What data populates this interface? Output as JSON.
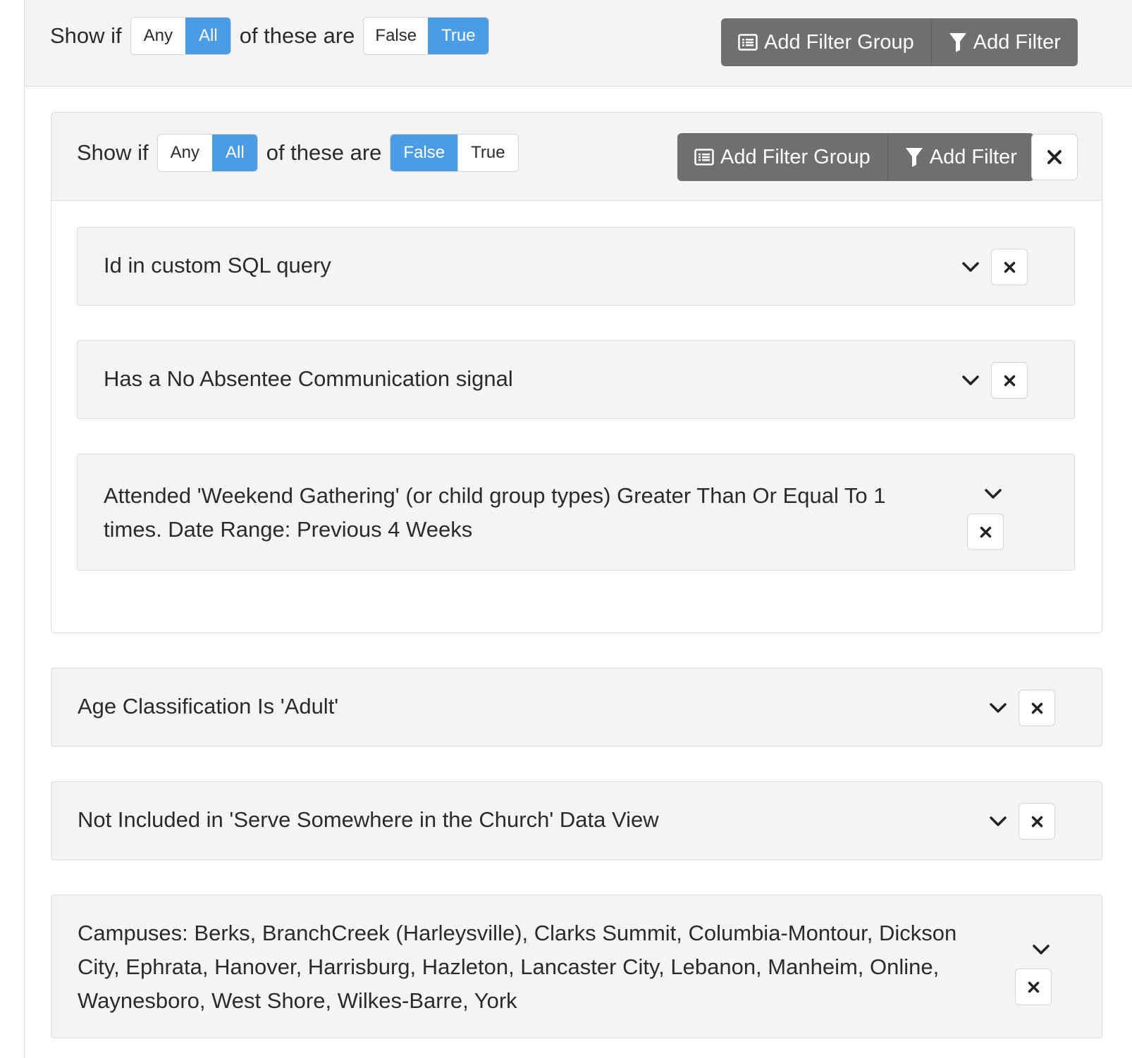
{
  "root": {
    "show_if": "Show if",
    "any": "Any",
    "all": "All",
    "of_these_are": "of these are",
    "false": "False",
    "true": "True",
    "selected_match": "All",
    "selected_value": "True",
    "add_filter_group": "Add Filter Group",
    "add_filter": "Add Filter"
  },
  "group": {
    "show_if": "Show if",
    "any": "Any",
    "all": "All",
    "of_these_are": "of these are",
    "false": "False",
    "true": "True",
    "selected_match": "All",
    "selected_value": "False",
    "add_filter_group": "Add Filter Group",
    "add_filter": "Add Filter",
    "filters": [
      {
        "label": "Id in custom SQL query"
      },
      {
        "label": "Has a No Absentee Communication signal"
      },
      {
        "label": "Attended 'Weekend Gathering' (or child group types) Greater Than Or Equal To 1 times. Date Range: Previous 4 Weeks"
      }
    ]
  },
  "filters": [
    {
      "label": "Age Classification Is 'Adult'"
    },
    {
      "label": "Not Included in 'Serve Somewhere in the Church' Data View"
    },
    {
      "label": "Campuses: Berks, BranchCreek (Harleysville), Clarks Summit, Columbia-Montour, Dickson City, Ephrata, Hanover, Harrisburg, Hazleton, Lancaster City, Lebanon, Manheim, Online, Waynesboro, West Shore, Wilkes-Barre, York"
    }
  ],
  "colors": {
    "accent": "#4a9ce5",
    "dark_button": "#6f6f6f",
    "panel_bg": "#f4f4f4"
  }
}
